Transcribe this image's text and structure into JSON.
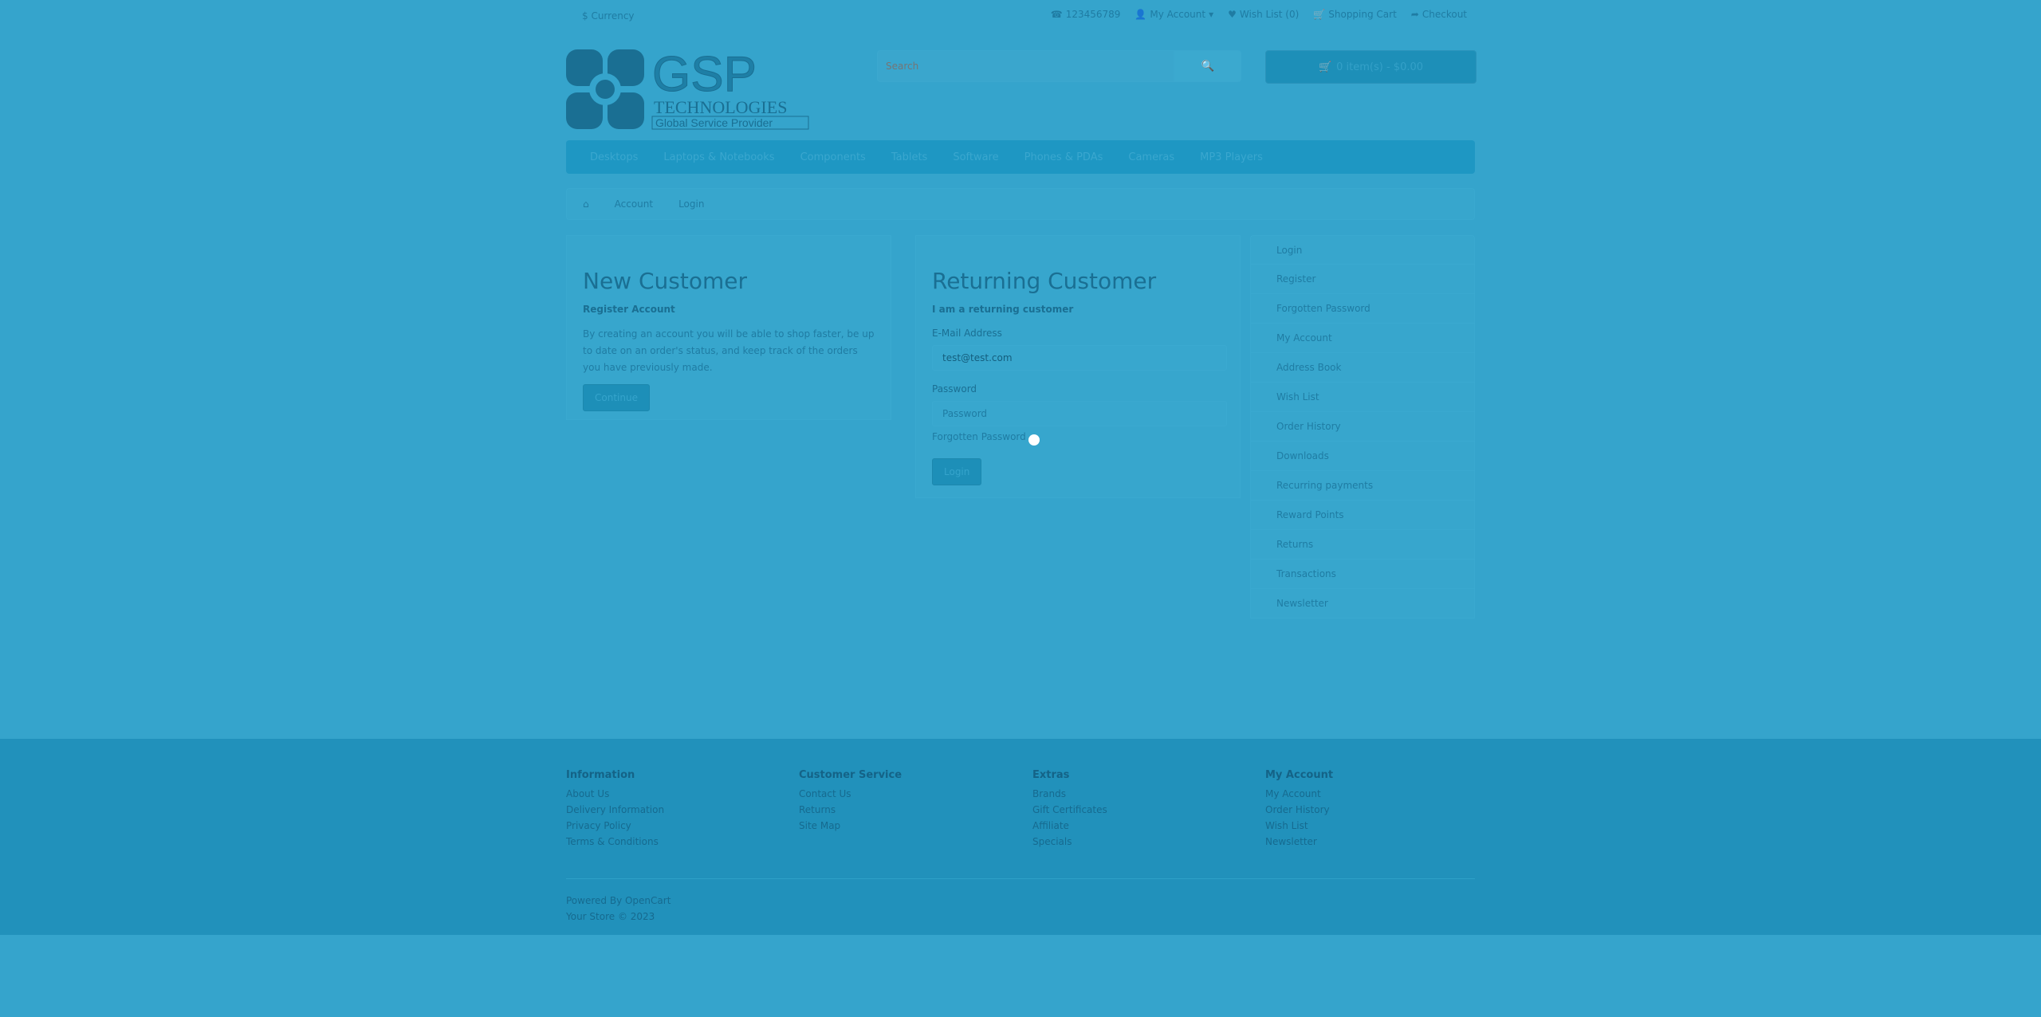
{
  "topbar": {
    "currency": "$ Currency",
    "phone": "123456789",
    "my_account": "My Account",
    "wish_list": "Wish List (0)",
    "shopping_cart": "Shopping Cart",
    "checkout": "Checkout"
  },
  "header": {
    "logo_main": "GSP",
    "logo_line1": "TECHNOLOGIES",
    "logo_line2": "Global Service Provider",
    "search_placeholder": "Search",
    "cart_label": "0 item(s) - $0.00"
  },
  "menu": {
    "items": [
      "Desktops",
      "Laptops & Notebooks",
      "Components",
      "Tablets",
      "Software",
      "Phones & PDAs",
      "Cameras",
      "MP3 Players"
    ]
  },
  "breadcrumb": {
    "items": [
      "Account",
      "Login"
    ]
  },
  "new_customer": {
    "title": "New Customer",
    "subtitle": "Register Account",
    "text": "By creating an account you will be able to shop faster, be up to date on an order's status, and keep track of the orders you have previously made.",
    "button": "Continue"
  },
  "returning_customer": {
    "title": "Returning Customer",
    "subtitle": "I am a returning customer",
    "email_label": "E-Mail Address",
    "email_value": "test@test.com",
    "password_label": "Password",
    "password_placeholder": "Password",
    "forgotten": "Forgotten Password",
    "button": "Login"
  },
  "account_links": [
    "Login",
    "Register",
    "Forgotten Password",
    "My Account",
    "Address Book",
    "Wish List",
    "Order History",
    "Downloads",
    "Recurring payments",
    "Reward Points",
    "Returns",
    "Transactions",
    "Newsletter"
  ],
  "footer": {
    "columns": [
      {
        "title": "Information",
        "links": [
          "About Us",
          "Delivery Information",
          "Privacy Policy",
          "Terms & Conditions"
        ]
      },
      {
        "title": "Customer Service",
        "links": [
          "Contact Us",
          "Returns",
          "Site Map"
        ]
      },
      {
        "title": "Extras",
        "links": [
          "Brands",
          "Gift Certificates",
          "Affiliate",
          "Specials"
        ]
      },
      {
        "title": "My Account",
        "links": [
          "My Account",
          "Order History",
          "Wish List",
          "Newsletter"
        ]
      }
    ],
    "powered": "Powered By OpenCart",
    "copyright": "Your Store © 2023"
  }
}
